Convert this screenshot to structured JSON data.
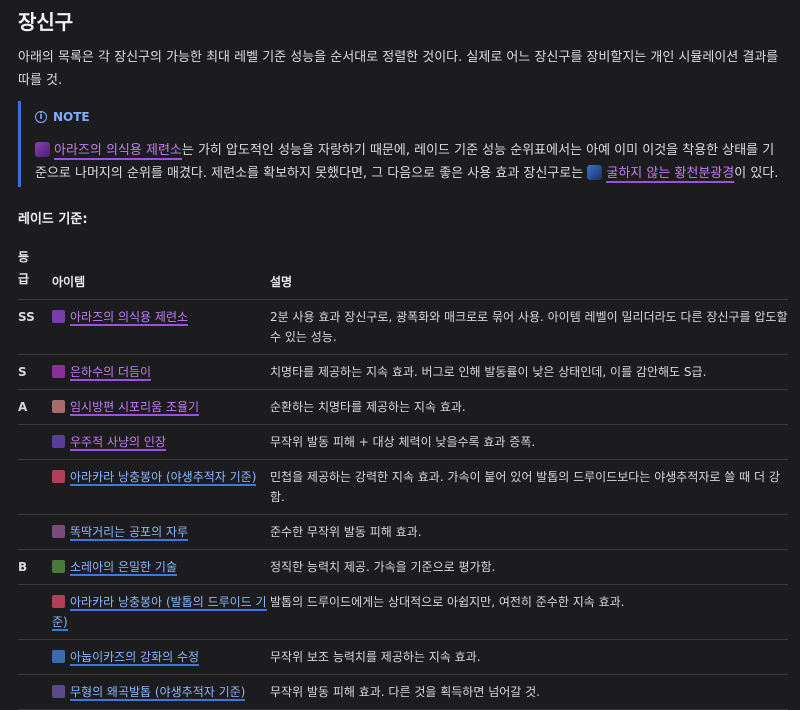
{
  "title": "장신구",
  "intro": "아래의 목록은 각 장신구의 가능한 최대 레벨 기준 성능을 순서대로 정렬한 것이다. 실제로 어느 장신구를 장비할지는 개인 시뮬레이션 결과를 따를 것.",
  "note": {
    "label": "NOTE",
    "link1": "아라즈의 의식용 제련소",
    "text1": "는 가히 압도적인 성능을 자랑하기 때문에, 레이드 기준 성능 순위표에서는 아예 이미 이것을 착용한 상태를 기준으로 나머지의 순위를 매겼다. 제련소를 확보하지 못했다면, 그 다음으로 좋은 사용 효과 장신구로는",
    "link2": "굴하지 않는 황천분광경",
    "text2": "이 있다."
  },
  "section_title": "레이드 기준:",
  "table": {
    "headers": {
      "tier_line1": "등",
      "tier_line2": "급",
      "item": "아이템",
      "desc": "설명"
    },
    "rows": [
      {
        "tier": "SS",
        "item": "아라즈의 의식용 제련소",
        "link_color": "purple",
        "icon_color": "#7a3ca8",
        "desc": "2분 사용 효과 장신구로, 광폭화와 매크로로 묶어 사용. 아이템 레벨이 밀리더라도 다른 장신구를 압도할 수 있는 성능."
      },
      {
        "tier": "S",
        "item": "은하수의 더듬이",
        "link_color": "purple",
        "icon_color": "#8a2f9a",
        "desc": "치명타를 제공하는 지속 효과. 버그로 인해 발동률이 낮은 상태인데, 이를 감안해도 S급."
      },
      {
        "tier": "A",
        "item": "임시방편 시포리움 조율기",
        "link_color": "purple",
        "icon_color": "#a86a6a",
        "desc": "순환하는 치명타를 제공하는 지속 효과."
      },
      {
        "tier": "",
        "item": "우주적 사냥의 인장",
        "link_color": "purple",
        "icon_color": "#5a3c9a",
        "desc": "무작위 발동 피해 + 대상 체력이 낮을수록 효과 증폭."
      },
      {
        "tier": "",
        "item": "아라카라 낭충봉아 (야생추적자 기준)",
        "link_color": "blue",
        "icon_color": "#b0405a",
        "desc": "민첩을 제공하는 강력한 지속 효과. 가속이 붙어 있어 발톱의 드루이드보다는 야생추적자로 쓸 때 더 강함."
      },
      {
        "tier": "",
        "item": "똑딱거리는 공포의 자루",
        "link_color": "blue",
        "icon_color": "#7a4a7a",
        "desc": "준수한 무작위 발동 피해 효과."
      },
      {
        "tier": "B",
        "item": "소레아의 은밀한 기술",
        "link_color": "blue",
        "icon_color": "#4a7a3a",
        "desc": "정직한 능력치 제공. 가속을 기준으로 평가함."
      },
      {
        "tier": "",
        "item": "아라카라 낭충봉아 (발톱의 드루이드 기준)",
        "link_color": "blue",
        "icon_color": "#b0405a",
        "desc": "발톱의 드루이드에게는 상대적으로 아쉽지만, 여전히 준수한 지속 효과."
      },
      {
        "tier": "",
        "item": "아눕이카즈의 강화의 수정",
        "link_color": "blue",
        "icon_color": "#3a6ab0",
        "desc": "무작위 보조 능력치를 제공하는 지속 효과."
      },
      {
        "tier": "",
        "item": "무형의 왜곡발톱 (야생추적자 기준)",
        "link_color": "blue",
        "icon_color": "#5a4a8a",
        "desc": "무작위 발동 피해 효과. 다른 것을 획득하면 넘어갈 것."
      }
    ]
  }
}
